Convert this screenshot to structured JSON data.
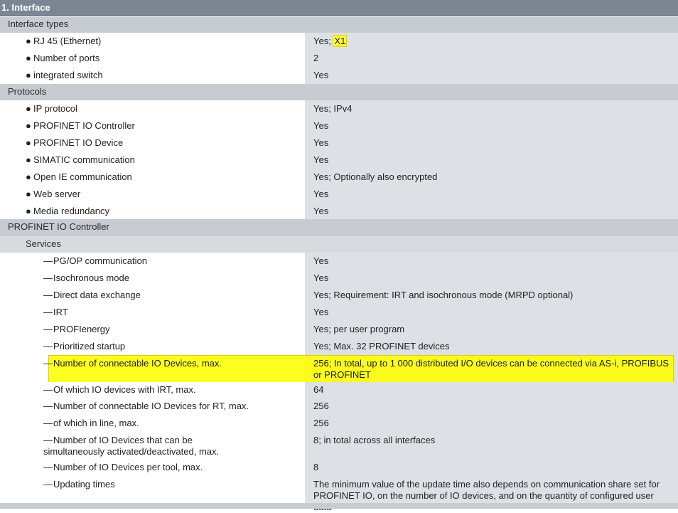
{
  "title": "1. Interface",
  "rows": [
    {
      "type": "section",
      "label": "Interface types"
    },
    {
      "type": "bullet",
      "label": "RJ 45 (Ethernet)",
      "value_prefix": "Yes; ",
      "value_highlight": "X1"
    },
    {
      "type": "bullet",
      "label": "Number of ports",
      "value": "2"
    },
    {
      "type": "bullet",
      "label": "integrated switch",
      "value": "Yes"
    },
    {
      "type": "section",
      "label": "Protocols"
    },
    {
      "type": "bullet",
      "label": "IP protocol",
      "value": "Yes; IPv4"
    },
    {
      "type": "bullet",
      "label": "PROFINET IO Controller",
      "value": "Yes"
    },
    {
      "type": "bullet",
      "label": "PROFINET IO Device",
      "value": "Yes"
    },
    {
      "type": "bullet",
      "label": "SIMATIC communication",
      "value": "Yes"
    },
    {
      "type": "bullet",
      "label": "Open IE communication",
      "value": "Yes; Optionally also encrypted"
    },
    {
      "type": "bullet",
      "label": "Web server",
      "value": "Yes"
    },
    {
      "type": "bullet",
      "label": "Media redundancy",
      "value": "Yes"
    },
    {
      "type": "section",
      "label": "PROFINET IO Controller"
    },
    {
      "type": "subsection",
      "label": "Services"
    },
    {
      "type": "dash",
      "label": "PG/OP communication",
      "value": "Yes"
    },
    {
      "type": "dash",
      "label": "Isochronous mode",
      "value": "Yes"
    },
    {
      "type": "dash",
      "label": "Direct data exchange",
      "value": "Yes; Requirement: IRT and isochronous mode (MRPD optional)"
    },
    {
      "type": "dash",
      "label": "IRT",
      "value": "Yes"
    },
    {
      "type": "dash",
      "label": "PROFIenergy",
      "value": "Yes; per user program"
    },
    {
      "type": "dash",
      "label": "Prioritized startup",
      "value": "Yes; Max. 32 PROFINET devices"
    },
    {
      "type": "dash",
      "label": "Number of connectable IO Devices, max.",
      "value": "256; In total, up to 1 000 distributed I/O devices can be connected via AS-i, PROFIBUS or PROFINET",
      "highlight": true
    },
    {
      "type": "dash",
      "label": "Of which IO devices with IRT, max.",
      "value": "64"
    },
    {
      "type": "dash",
      "label": "Number of connectable IO Devices for RT, max.",
      "value": "256"
    },
    {
      "type": "dash",
      "label": "of which in line, max.",
      "value": "256"
    },
    {
      "type": "dash",
      "label": "Number of IO Devices that can be simultaneously activated/deactivated, max.",
      "value": "8; in total across all interfaces"
    },
    {
      "type": "dash",
      "label": "Number of IO Devices per tool, max.",
      "value": "8"
    },
    {
      "type": "dash",
      "label": "Updating times",
      "value": "The minimum value of the update time also depends on communication share set for PROFINET IO, on the number of IO devices, and on the quantity of configured user data"
    }
  ]
}
